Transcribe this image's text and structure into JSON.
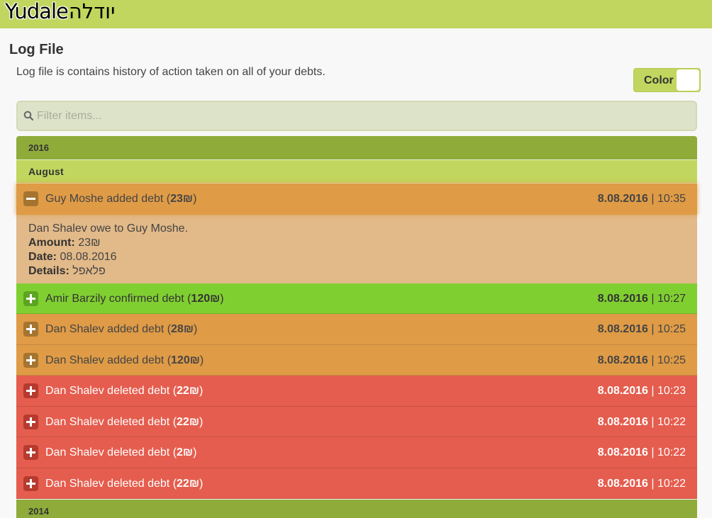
{
  "app": {
    "logo_en": "Yudale",
    "logo_he": "יודלה"
  },
  "page": {
    "title": "Log File",
    "description": "Log file is contains history of action taken on all of your debts."
  },
  "color_toggle": {
    "label": "Color",
    "state": "off"
  },
  "filter": {
    "placeholder": "Filter items..."
  },
  "groups": {
    "year_2016": "2016",
    "month_august": "August",
    "year_2014": "2014"
  },
  "entries": [
    {
      "person": "Guy Moshe",
      "action": "added debt",
      "amount": "23₪",
      "date": "8.08.2016",
      "time": "10:35",
      "color": "orange",
      "expanded": true
    },
    {
      "person": "Amir Barzily",
      "action": "confirmed debt",
      "amount": "120₪",
      "date": "8.08.2016",
      "time": "10:27",
      "color": "green"
    },
    {
      "person": "Dan Shalev",
      "action": "added debt",
      "amount": "28₪",
      "date": "8.08.2016",
      "time": "10:25",
      "color": "orange"
    },
    {
      "person": "Dan Shalev",
      "action": "added debt",
      "amount": "120₪",
      "date": "8.08.2016",
      "time": "10:25",
      "color": "orange"
    },
    {
      "person": "Dan Shalev",
      "action": "deleted debt",
      "amount": "22₪",
      "date": "8.08.2016",
      "time": "10:23",
      "color": "red"
    },
    {
      "person": "Dan Shalev",
      "action": "deleted debt",
      "amount": "22₪",
      "date": "8.08.2016",
      "time": "10:22",
      "color": "red"
    },
    {
      "person": "Dan Shalev",
      "action": "deleted debt",
      "amount": "2₪",
      "date": "8.08.2016",
      "time": "10:22",
      "color": "red"
    },
    {
      "person": "Dan Shalev",
      "action": "deleted debt",
      "amount": "22₪",
      "date": "8.08.2016",
      "time": "10:22",
      "color": "red"
    }
  ],
  "details": {
    "summary": "Dan Shalev owe to Guy Moshe.",
    "amount_label": "Amount:",
    "amount_value": "23₪",
    "date_label": "Date:",
    "date_value": "08.08.2016",
    "details_label": "Details:",
    "details_value": "פלאפל"
  },
  "colors": {
    "topbar": "#c1d65e",
    "year_header": "#8fac3a",
    "month_header": "#c1d65e",
    "orange": "#df9b46",
    "green": "#80cf31",
    "red": "#e55d4e",
    "details_bg": "#e2b988"
  },
  "icons": {
    "expand": "plus-icon",
    "collapse": "minus-icon",
    "search": "search-icon"
  }
}
